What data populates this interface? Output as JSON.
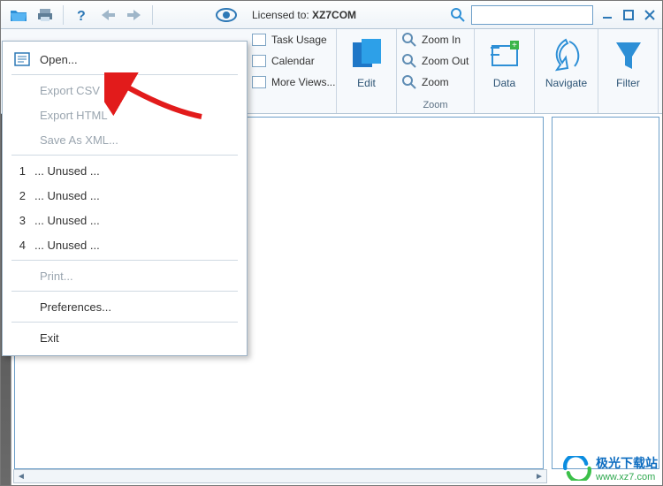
{
  "topbar": {
    "license_prefix": "Licensed to: ",
    "license_value": "XZ7COM"
  },
  "ribbon": {
    "views_col": {
      "items": [
        "Task Usage",
        "Calendar",
        "More Views..."
      ]
    },
    "edit": "Edit",
    "zoom": {
      "in": "Zoom In",
      "out": "Zoom Out",
      "reset": "Zoom",
      "group": "Zoom"
    },
    "data": "Data",
    "navigate": "Navigate",
    "filter": "Filter"
  },
  "menu": {
    "open": "Open...",
    "export_csv": "Export CSV",
    "export_html": "Export HTML",
    "save_xml": "Save As XML...",
    "recent": [
      {
        "n": "1",
        "label": "... Unused ..."
      },
      {
        "n": "2",
        "label": "... Unused ..."
      },
      {
        "n": "3",
        "label": "... Unused ..."
      },
      {
        "n": "4",
        "label": "... Unused ..."
      }
    ],
    "print": "Print...",
    "prefs": "Preferences...",
    "exit": "Exit"
  },
  "watermark": {
    "line1": "极光下载站",
    "line2": "www.xz7.com"
  }
}
